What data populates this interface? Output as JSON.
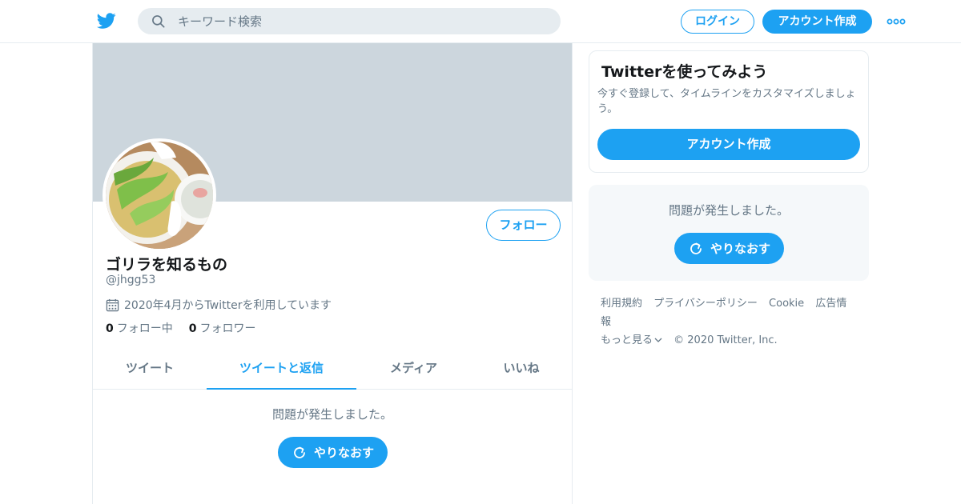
{
  "header": {
    "search_placeholder": "キーワード検索",
    "login_label": "ログイン",
    "signup_label": "アカウント作成",
    "logo_icon": "twitter-bird-icon",
    "more_icon": "more-dots-icon",
    "accent_color": "#1da1f2"
  },
  "profile": {
    "name": "ゴリラを知るもの",
    "handle": "@jhgg53",
    "joined": "2020年4月からTwitterを利用しています",
    "follow_label": "フォロー",
    "following_count": "0",
    "following_label": "フォロー中",
    "followers_count": "0",
    "followers_label": "フォロワー"
  },
  "tabs": [
    {
      "label": "ツイート",
      "active": false
    },
    {
      "label": "ツイートと返信",
      "active": true
    },
    {
      "label": "メディア",
      "active": false
    },
    {
      "label": "いいね",
      "active": false
    }
  ],
  "timeline": {
    "error_text": "問題が発生しました。",
    "retry_label": "やりなおす"
  },
  "sidebar": {
    "signup_card": {
      "title": "Twitterを使ってみよう",
      "text": "今すぐ登録して、タイムラインをカスタマイズしましょう。",
      "button_label": "アカウント作成"
    },
    "trends_card": {
      "error_text": "問題が発生しました。",
      "retry_label": "やりなおす"
    },
    "footer": {
      "links": [
        "利用規約",
        "プライバシーポリシー",
        "Cookie",
        "広告情報"
      ],
      "more_label": "もっと見る",
      "copyright": "© 2020 Twitter, Inc."
    }
  }
}
